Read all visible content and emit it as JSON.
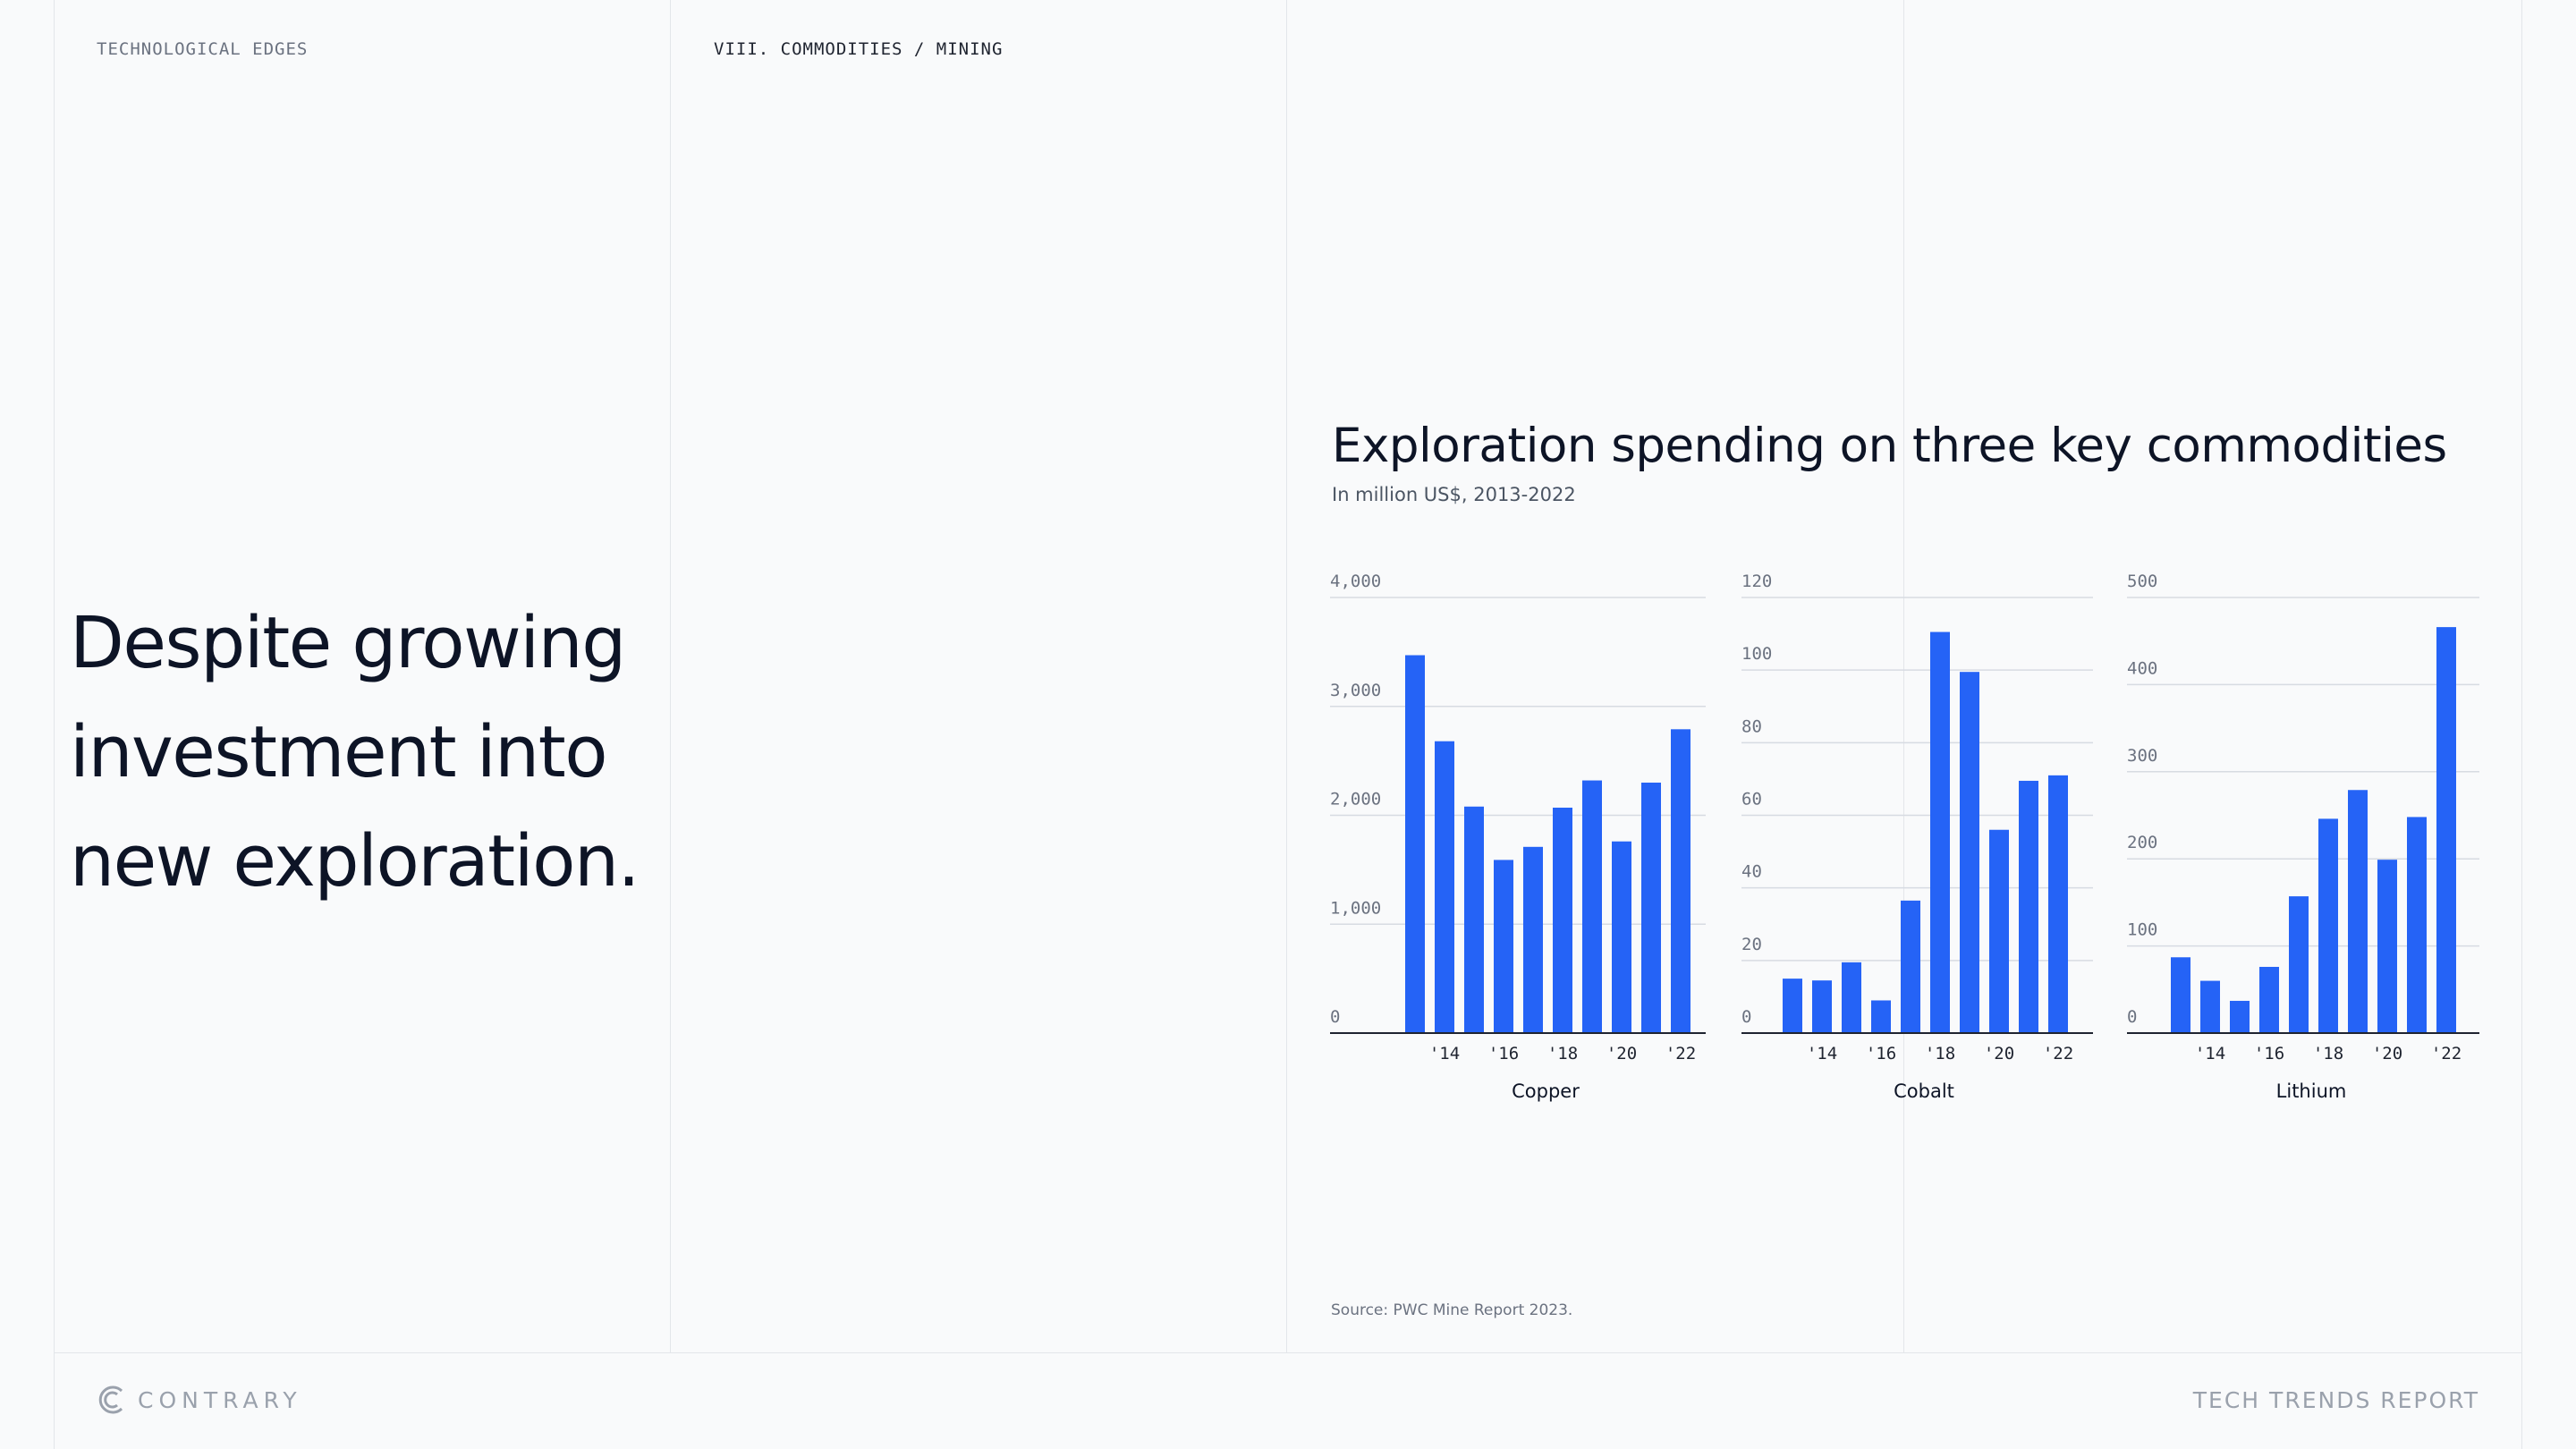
{
  "header": {
    "section_label": "TECHNOLOGICAL EDGES",
    "breadcrumb": "VIII. COMMODITIES / MINING"
  },
  "headline": "Despite growing investment into new exploration.",
  "colors": {
    "bar": "#2563f6",
    "grid": "#d7dbe2",
    "axis": "#1f2430"
  },
  "chart_data": [
    {
      "type": "bar",
      "title": "Exploration spending on three key commodities",
      "subtitle": "In million US$, 2013-2022",
      "xlabel": "Copper",
      "ylabel": "",
      "categories": [
        "2013",
        "2014",
        "2015",
        "2016",
        "2017",
        "2018",
        "2019",
        "2020",
        "2021",
        "2022"
      ],
      "tick_labels": [
        "'14",
        "'16",
        "'18",
        "'20",
        "'22"
      ],
      "y_ticks": [
        "0",
        "1,000",
        "2,000",
        "3,000",
        "4,000"
      ],
      "ylim": [
        0,
        4000
      ],
      "values": [
        3470,
        2680,
        2080,
        1590,
        1710,
        2070,
        2320,
        1760,
        2300,
        2790
      ],
      "grid": true
    },
    {
      "type": "bar",
      "xlabel": "Cobalt",
      "ylabel": "",
      "categories": [
        "2013",
        "2014",
        "2015",
        "2016",
        "2017",
        "2018",
        "2019",
        "2020",
        "2021",
        "2022"
      ],
      "tick_labels": [
        "'14",
        "'16",
        "'18",
        "'20",
        "'22"
      ],
      "y_ticks": [
        "0",
        "20",
        "40",
        "60",
        "80",
        "100",
        "120"
      ],
      "ylim": [
        0,
        120
      ],
      "values": [
        15,
        14.5,
        19.5,
        9,
        36.5,
        110.5,
        99.5,
        56,
        69.5,
        71
      ],
      "grid": true
    },
    {
      "type": "bar",
      "xlabel": "Lithium",
      "ylabel": "",
      "categories": [
        "2013",
        "2014",
        "2015",
        "2016",
        "2017",
        "2018",
        "2019",
        "2020",
        "2021",
        "2022"
      ],
      "tick_labels": [
        "'14",
        "'16",
        "'18",
        "'20",
        "'22"
      ],
      "y_ticks": [
        "0",
        "100",
        "200",
        "300",
        "400",
        "500"
      ],
      "ylim": [
        0,
        500
      ],
      "values": [
        87,
        60,
        37,
        76,
        157,
        246,
        279,
        199,
        248,
        466
      ],
      "grid": true
    }
  ],
  "source": "Source: PWC Mine Report 2023.",
  "footer": {
    "logo_text": "CONTRARY",
    "report_name": "TECH TRENDS REPORT"
  }
}
